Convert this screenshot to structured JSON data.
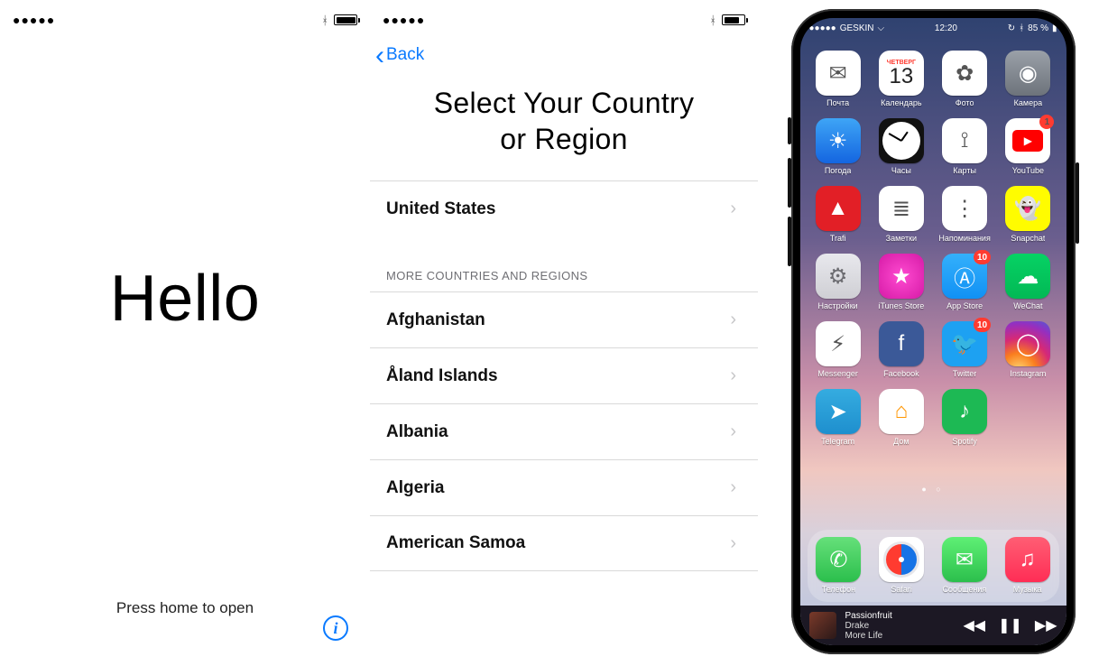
{
  "panel1": {
    "greeting": "Hello",
    "hint": "Press home to open"
  },
  "panel2": {
    "back": "Back",
    "title_line1": "Select Your Country",
    "title_line2": "or Region",
    "primary": "United States",
    "section_label": "MORE COUNTRIES AND REGIONS",
    "countries": [
      "Afghanistan",
      "Åland Islands",
      "Albania",
      "Algeria",
      "American Samoa"
    ]
  },
  "panel3": {
    "status": {
      "carrier": "GESKIN",
      "time": "12:20",
      "battery_pct": "85 %"
    },
    "apps": [
      {
        "label": "Почта",
        "icon": "mail",
        "bg": "bg-white",
        "glyph": "✉︎"
      },
      {
        "label": "Календарь",
        "icon": "calendar",
        "bg": "bg-white",
        "weekday": "ЧЕТВЕРГ",
        "day": "13"
      },
      {
        "label": "Фото",
        "icon": "photos",
        "bg": "bg-white",
        "glyph": "✿"
      },
      {
        "label": "Камера",
        "icon": "camera",
        "bg": "bg-grey",
        "glyph": "◉"
      },
      {
        "label": "Погода",
        "icon": "weather",
        "bg": "bg-grad-blue",
        "glyph": "☀︎"
      },
      {
        "label": "Часы",
        "icon": "clock",
        "bg": "bg-dark",
        "clock": true
      },
      {
        "label": "Карты",
        "icon": "maps",
        "bg": "bg-white",
        "glyph": "⟟"
      },
      {
        "label": "YouTube",
        "icon": "youtube",
        "bg": "bg-white",
        "yt": true,
        "badge": "1"
      },
      {
        "label": "Trafi",
        "icon": "trafi",
        "bg": "bg-red",
        "glyph": "▲"
      },
      {
        "label": "Заметки",
        "icon": "notes",
        "bg": "bg-white",
        "glyph": "≣"
      },
      {
        "label": "Напоминания",
        "icon": "reminders",
        "bg": "bg-white",
        "glyph": "⋮"
      },
      {
        "label": "Snapchat",
        "icon": "snapchat",
        "bg": "bg-yellow",
        "glyph": "👻"
      },
      {
        "label": "Настройки",
        "icon": "settings",
        "bg": "bg-settings",
        "glyph": "⚙︎"
      },
      {
        "label": "iTunes Store",
        "icon": "itunes",
        "bg": "bg-pink",
        "glyph": "★"
      },
      {
        "label": "App Store",
        "icon": "appstore",
        "bg": "bg-blue",
        "glyph": "Ⓐ",
        "badge": "10"
      },
      {
        "label": "WeChat",
        "icon": "wechat",
        "bg": "bg-wechat",
        "glyph": "☁︎"
      },
      {
        "label": "Messenger",
        "icon": "messenger",
        "bg": "bg-white",
        "glyph": "⚡︎"
      },
      {
        "label": "Facebook",
        "icon": "facebook",
        "bg": "bg-fb",
        "glyph": "f"
      },
      {
        "label": "Twitter",
        "icon": "twitter",
        "bg": "bg-tw",
        "glyph": "🐦",
        "badge": "10"
      },
      {
        "label": "Instagram",
        "icon": "instagram",
        "bg": "bg-ig",
        "glyph": "◯"
      },
      {
        "label": "Telegram",
        "icon": "telegram",
        "bg": "bg-tg",
        "glyph": "➤"
      },
      {
        "label": "Дом",
        "icon": "home",
        "bg": "bg-home",
        "glyph": "⌂"
      },
      {
        "label": "Spotify",
        "icon": "spotify",
        "bg": "bg-spotify",
        "glyph": "♪"
      }
    ],
    "dock": [
      {
        "label": "Телефон",
        "icon": "phone",
        "bg": "bg-phone",
        "glyph": "✆"
      },
      {
        "label": "Safari",
        "icon": "safari",
        "bg": "bg-safari",
        "compass": true
      },
      {
        "label": "Сообщения",
        "icon": "messages",
        "bg": "bg-msg",
        "glyph": "✉︎"
      },
      {
        "label": "Музыка",
        "icon": "music",
        "bg": "bg-music",
        "glyph": "♫"
      }
    ],
    "nowplaying": {
      "title": "Passionfruit",
      "artist": "Drake",
      "album": "More Life"
    }
  }
}
